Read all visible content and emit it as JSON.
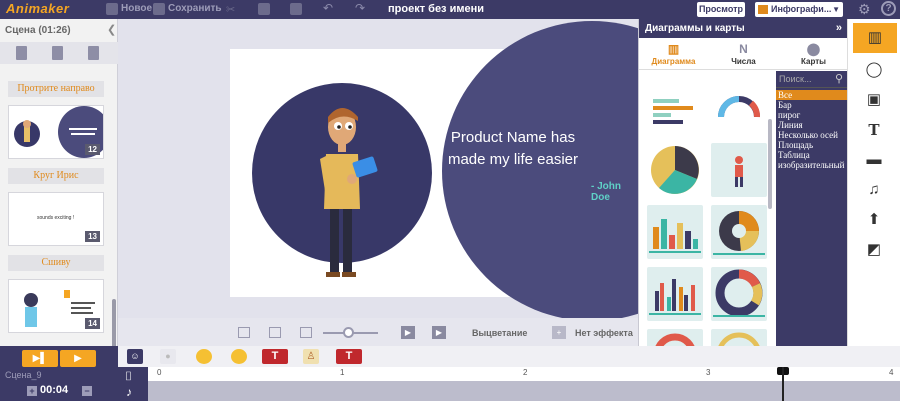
{
  "topbar": {
    "logo": "Animaker",
    "new_label": "Новое",
    "save_label": "Сохранить",
    "project_title": "проект без имени",
    "preview_label": "Просмотр",
    "template_label": "Инфографи..."
  },
  "scenes": {
    "header": "Сцена",
    "duration": "(01:26)",
    "transitions": [
      "Протрите направо",
      "Круг Ирис",
      "Сшиву"
    ],
    "thumb_numbers": [
      "12",
      "13",
      "14"
    ],
    "thumb13_text": "sounds exciting !"
  },
  "canvas": {
    "text_line1": "Product Name has",
    "text_line2": "made my life easier",
    "author": "- John Doe"
  },
  "controls": {
    "fade_label": "Выцветание",
    "no_effect_label": "Нет эффекта"
  },
  "chart_panel": {
    "title": "Диаграммы и карты",
    "tabs": [
      {
        "label": "Диаграмма",
        "icon": "bar-chart-icon",
        "active": true
      },
      {
        "label": "Числа",
        "icon": "n-letter-icon",
        "active": false
      },
      {
        "label": "Карты",
        "icon": "map-pin-icon",
        "active": false
      }
    ],
    "search_placeholder": "Поиск...",
    "filters": [
      "Все",
      "Бар",
      "пирог",
      "Линия",
      "Несколько осей",
      "Площадь",
      "Таблица",
      "изобразительный"
    ],
    "selected_filter": "Все"
  },
  "right_toolbar": [
    "chart-icon",
    "map-pin-icon",
    "image-icon",
    "text-icon",
    "video-icon",
    "music-icon",
    "upload-icon",
    "background-icon"
  ],
  "timeline": {
    "scene_label": "Сцена_9",
    "time": "00:04",
    "ruler_ticks": [
      "0",
      "1",
      "2",
      "3",
      "4"
    ]
  },
  "colors": {
    "accent": "#f5a623",
    "navy": "#3c3a66"
  }
}
